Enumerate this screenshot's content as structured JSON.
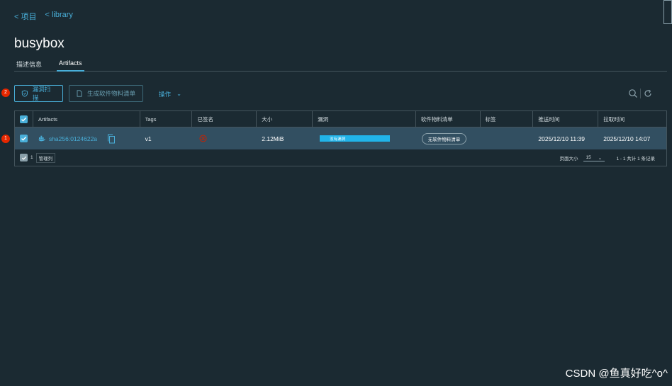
{
  "breadcrumb": {
    "items": [
      "< 项目",
      "< library"
    ]
  },
  "page": {
    "title": "busybox"
  },
  "tabs": [
    {
      "label": "描述信息",
      "active": false
    },
    {
      "label": "Artifacts",
      "active": true
    }
  ],
  "toolbar": {
    "scan_label": "漏洞扫描",
    "sbom_label": "生成软件物料清单",
    "ops_label": "操作",
    "search_icon": "search-icon",
    "refresh_icon": "refresh-icon"
  },
  "badges": {
    "toolbar": "2",
    "row": "1"
  },
  "table": {
    "headers": [
      "Artifacts",
      "Tags",
      "已签名",
      "大小",
      "漏洞",
      "软件物料清单",
      "标签",
      "推送时间",
      "拉取时间"
    ],
    "rows": [
      {
        "artifact": "sha256:0124622a",
        "tags": "v1",
        "signed": "",
        "size": "2.12MiB",
        "vulnerability": "没有漏洞",
        "sbom": "无软件物料清单",
        "labels": "",
        "push_time": "2025/12/10 11:39",
        "pull_time": "2025/12/10 14:07"
      }
    ],
    "footer": {
      "selected_count": "1",
      "manage_columns": "管理列",
      "page_size_label": "页面大小",
      "page_size_value": "15",
      "summary": "1 - 1 共计 1 条记录"
    }
  },
  "watermark": "CSDN @鱼真好吃^o^",
  "colors": {
    "accent": "#49afd9",
    "row_selected": "#324f61",
    "background": "#1b2a32",
    "badge": "#e62700"
  }
}
